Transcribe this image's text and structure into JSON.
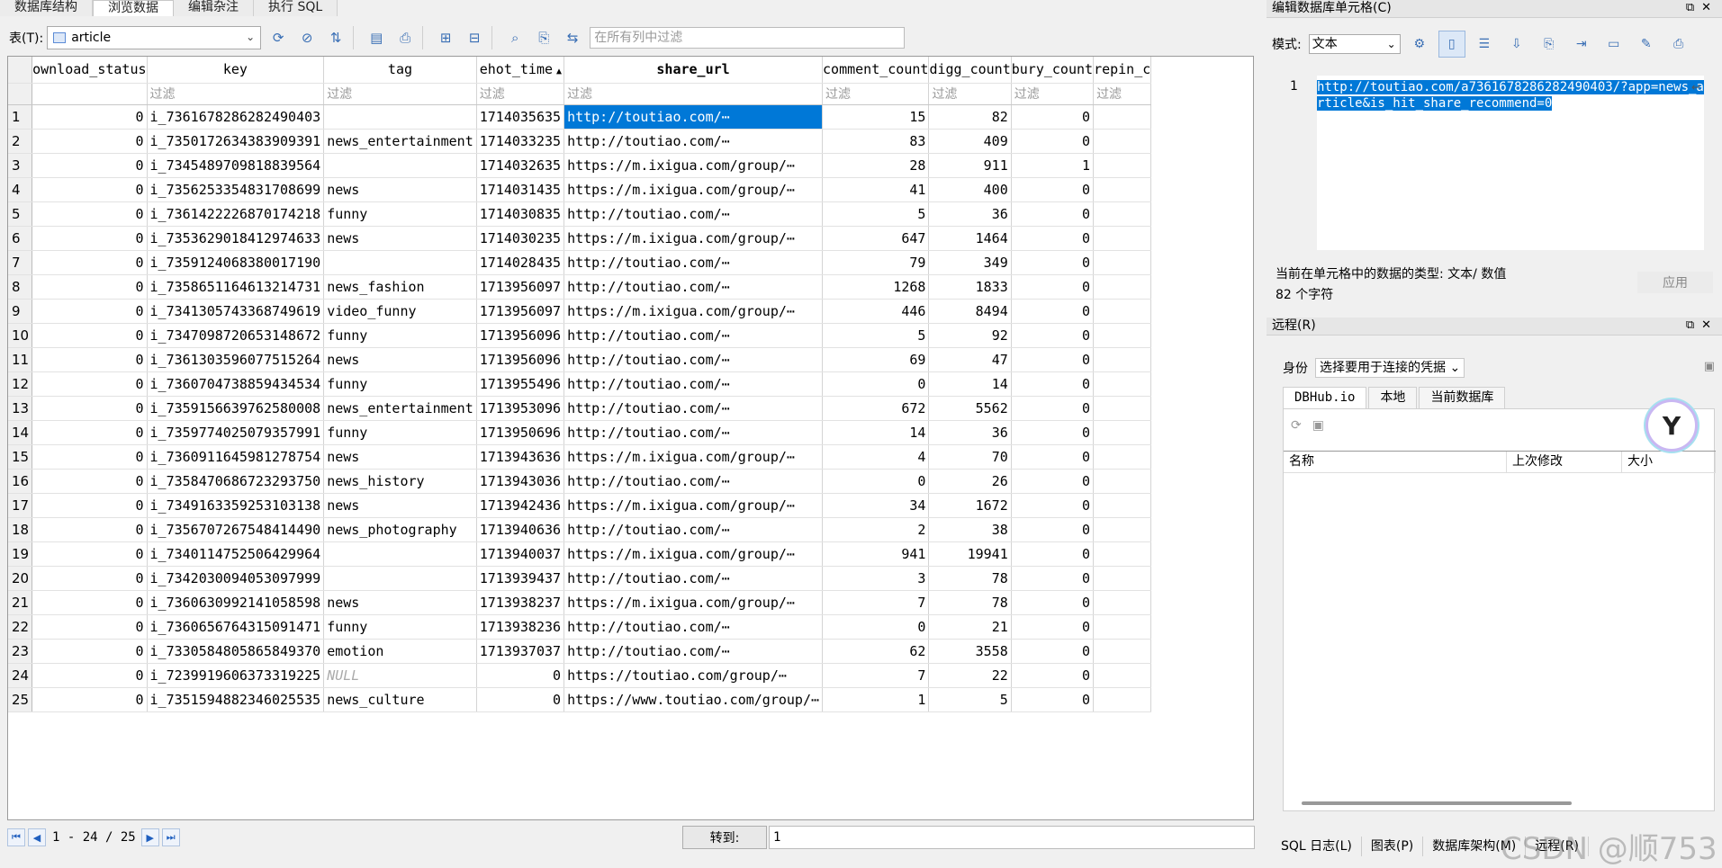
{
  "tabs": [
    "数据库结构",
    "浏览数据",
    "编辑杂注",
    "执行 SQL"
  ],
  "toolbar": {
    "table_label": "表(T):",
    "table_value": "article",
    "filter_all_placeholder": "在所有列中过滤"
  },
  "grid": {
    "columns": [
      "ownload_status",
      "key",
      "tag",
      "ehot_time",
      "share_url",
      "comment_count",
      "digg_count",
      "bury_count",
      "repin_c"
    ],
    "sorted_column": "ehot_time",
    "filter_placeholder": "过滤",
    "rows": [
      {
        "n": "1",
        "download_status": "0",
        "key": "i_7361678286282490403",
        "tag": "",
        "time": "1714035635",
        "url": "http://toutiao.com/⋯",
        "comment": "15",
        "digg": "82",
        "bury": "0"
      },
      {
        "n": "2",
        "download_status": "0",
        "key": "i_7350172634383909391",
        "tag": "news_entertainment",
        "time": "1714033235",
        "url": "http://toutiao.com/⋯",
        "comment": "83",
        "digg": "409",
        "bury": "0"
      },
      {
        "n": "3",
        "download_status": "0",
        "key": "i_7345489709818839564",
        "tag": "",
        "time": "1714032635",
        "url": "https://m.ixigua.com/group/⋯",
        "comment": "28",
        "digg": "911",
        "bury": "1"
      },
      {
        "n": "4",
        "download_status": "0",
        "key": "i_7356253354831708699",
        "tag": "news",
        "time": "1714031435",
        "url": "https://m.ixigua.com/group/⋯",
        "comment": "41",
        "digg": "400",
        "bury": "0"
      },
      {
        "n": "5",
        "download_status": "0",
        "key": "i_7361422226870174218",
        "tag": "funny",
        "time": "1714030835",
        "url": "http://toutiao.com/⋯",
        "comment": "5",
        "digg": "36",
        "bury": "0"
      },
      {
        "n": "6",
        "download_status": "0",
        "key": "i_7353629018412974633",
        "tag": "news",
        "time": "1714030235",
        "url": "https://m.ixigua.com/group/⋯",
        "comment": "647",
        "digg": "1464",
        "bury": "0"
      },
      {
        "n": "7",
        "download_status": "0",
        "key": "i_7359124068380017190",
        "tag": "",
        "time": "1714028435",
        "url": "http://toutiao.com/⋯",
        "comment": "79",
        "digg": "349",
        "bury": "0"
      },
      {
        "n": "8",
        "download_status": "0",
        "key": "i_7358651164613214731",
        "tag": "news_fashion",
        "time": "1713956097",
        "url": "http://toutiao.com/⋯",
        "comment": "1268",
        "digg": "1833",
        "bury": "0"
      },
      {
        "n": "9",
        "download_status": "0",
        "key": "i_7341305743368749619",
        "tag": "video_funny",
        "time": "1713956097",
        "url": "https://m.ixigua.com/group/⋯",
        "comment": "446",
        "digg": "8494",
        "bury": "0"
      },
      {
        "n": "10",
        "download_status": "0",
        "key": "i_7347098720653148672",
        "tag": "funny",
        "time": "1713956096",
        "url": "http://toutiao.com/⋯",
        "comment": "5",
        "digg": "92",
        "bury": "0"
      },
      {
        "n": "11",
        "download_status": "0",
        "key": "i_7361303596077515264",
        "tag": "news",
        "time": "1713956096",
        "url": "http://toutiao.com/⋯",
        "comment": "69",
        "digg": "47",
        "bury": "0"
      },
      {
        "n": "12",
        "download_status": "0",
        "key": "i_7360704738859434534",
        "tag": "funny",
        "time": "1713955496",
        "url": "http://toutiao.com/⋯",
        "comment": "0",
        "digg": "14",
        "bury": "0"
      },
      {
        "n": "13",
        "download_status": "0",
        "key": "i_7359156639762580008",
        "tag": "news_entertainment",
        "time": "1713953096",
        "url": "http://toutiao.com/⋯",
        "comment": "672",
        "digg": "5562",
        "bury": "0"
      },
      {
        "n": "14",
        "download_status": "0",
        "key": "i_7359774025079357991",
        "tag": "funny",
        "time": "1713950696",
        "url": "http://toutiao.com/⋯",
        "comment": "14",
        "digg": "36",
        "bury": "0"
      },
      {
        "n": "15",
        "download_status": "0",
        "key": "i_7360911645981278754",
        "tag": "news",
        "time": "1713943636",
        "url": "https://m.ixigua.com/group/⋯",
        "comment": "4",
        "digg": "70",
        "bury": "0"
      },
      {
        "n": "16",
        "download_status": "0",
        "key": "i_7358470686723293750",
        "tag": "news_history",
        "time": "1713943036",
        "url": "http://toutiao.com/⋯",
        "comment": "0",
        "digg": "26",
        "bury": "0"
      },
      {
        "n": "17",
        "download_status": "0",
        "key": "i_7349163359253103138",
        "tag": "news",
        "time": "1713942436",
        "url": "https://m.ixigua.com/group/⋯",
        "comment": "34",
        "digg": "1672",
        "bury": "0"
      },
      {
        "n": "18",
        "download_status": "0",
        "key": "i_7356707267548414490",
        "tag": "news_photography",
        "time": "1713940636",
        "url": "http://toutiao.com/⋯",
        "comment": "2",
        "digg": "38",
        "bury": "0"
      },
      {
        "n": "19",
        "download_status": "0",
        "key": "i_7340114752506429964",
        "tag": "",
        "time": "1713940037",
        "url": "https://m.ixigua.com/group/⋯",
        "comment": "941",
        "digg": "19941",
        "bury": "0"
      },
      {
        "n": "20",
        "download_status": "0",
        "key": "i_7342030094053097999",
        "tag": "",
        "time": "1713939437",
        "url": "http://toutiao.com/⋯",
        "comment": "3",
        "digg": "78",
        "bury": "0"
      },
      {
        "n": "21",
        "download_status": "0",
        "key": "i_7360630992141058598",
        "tag": "news",
        "time": "1713938237",
        "url": "https://m.ixigua.com/group/⋯",
        "comment": "7",
        "digg": "78",
        "bury": "0"
      },
      {
        "n": "22",
        "download_status": "0",
        "key": "i_7360656764315091471",
        "tag": "funny",
        "time": "1713938236",
        "url": "http://toutiao.com/⋯",
        "comment": "0",
        "digg": "21",
        "bury": "0"
      },
      {
        "n": "23",
        "download_status": "0",
        "key": "i_7330584805865849370",
        "tag": "emotion",
        "time": "1713937037",
        "url": "http://toutiao.com/⋯",
        "comment": "62",
        "digg": "3558",
        "bury": "0"
      },
      {
        "n": "24",
        "download_status": "0",
        "key": "i_7239919606373319225",
        "tag": "NULL",
        "time": "0",
        "url": "https://toutiao.com/group/⋯",
        "comment": "7",
        "digg": "22",
        "bury": "0"
      },
      {
        "n": "25",
        "download_status": "0",
        "key": "i_7351594882346025535",
        "tag": "news_culture",
        "time": "0",
        "url": "https://www.toutiao.com/group/⋯",
        "comment": "1",
        "digg": "5",
        "bury": "0"
      }
    ]
  },
  "pager": {
    "range": "1 - 24 / 25",
    "goto_label": "转到:",
    "goto_value": "1"
  },
  "edit_cell": {
    "title": "编辑数据库单元格(C)",
    "mode_label": "模式:",
    "mode_value": "文本",
    "line_number": "1",
    "content": "http://toutiao.com/a7361678286282490403/?app=news_article&is_hit_share_recommend=0",
    "type_info": "当前在单元格中的数据的类型: 文本/ 数值",
    "char_count": "82 个字符",
    "apply_label": "应用"
  },
  "remote": {
    "title": "远程(R)",
    "identity_label": "身份",
    "identity_value": "选择要用于连接的凭据",
    "tabs": [
      "DBHub.io",
      "本地",
      "当前数据库"
    ],
    "columns": [
      "名称",
      "上次修改",
      "大小"
    ]
  },
  "bottom_tabs": [
    "SQL 日志(L)",
    "图表(P)",
    "数据库架构(M)",
    "远程(R)"
  ],
  "watermark": "CSDN @顺753",
  "colors": {
    "selection": "#0078d7",
    "accent": "#3a6fb5"
  }
}
